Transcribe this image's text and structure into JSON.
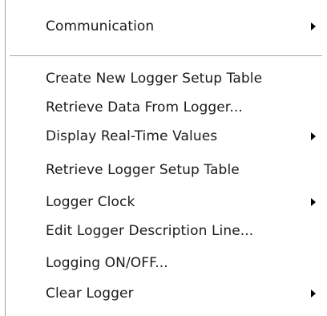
{
  "menu": {
    "items": [
      {
        "label": "Communication",
        "submenu": true
      },
      {
        "label": "Create New Logger Setup Table",
        "submenu": false
      },
      {
        "label": "Retrieve Data From Logger...",
        "submenu": false
      },
      {
        "label": "Display Real-Time Values",
        "submenu": true
      },
      {
        "label": "Retrieve Logger Setup Table",
        "submenu": false
      },
      {
        "label": "Logger Clock",
        "submenu": true
      },
      {
        "label": "Edit Logger Description Line...",
        "submenu": false
      },
      {
        "label": "Logging ON/OFF...",
        "submenu": false
      },
      {
        "label": "Clear Logger",
        "submenu": true
      }
    ],
    "colors": {
      "background": "#ffffff",
      "text": "#1a1a1a",
      "separator": "#a8a8a8",
      "arrow": "#000000"
    }
  }
}
